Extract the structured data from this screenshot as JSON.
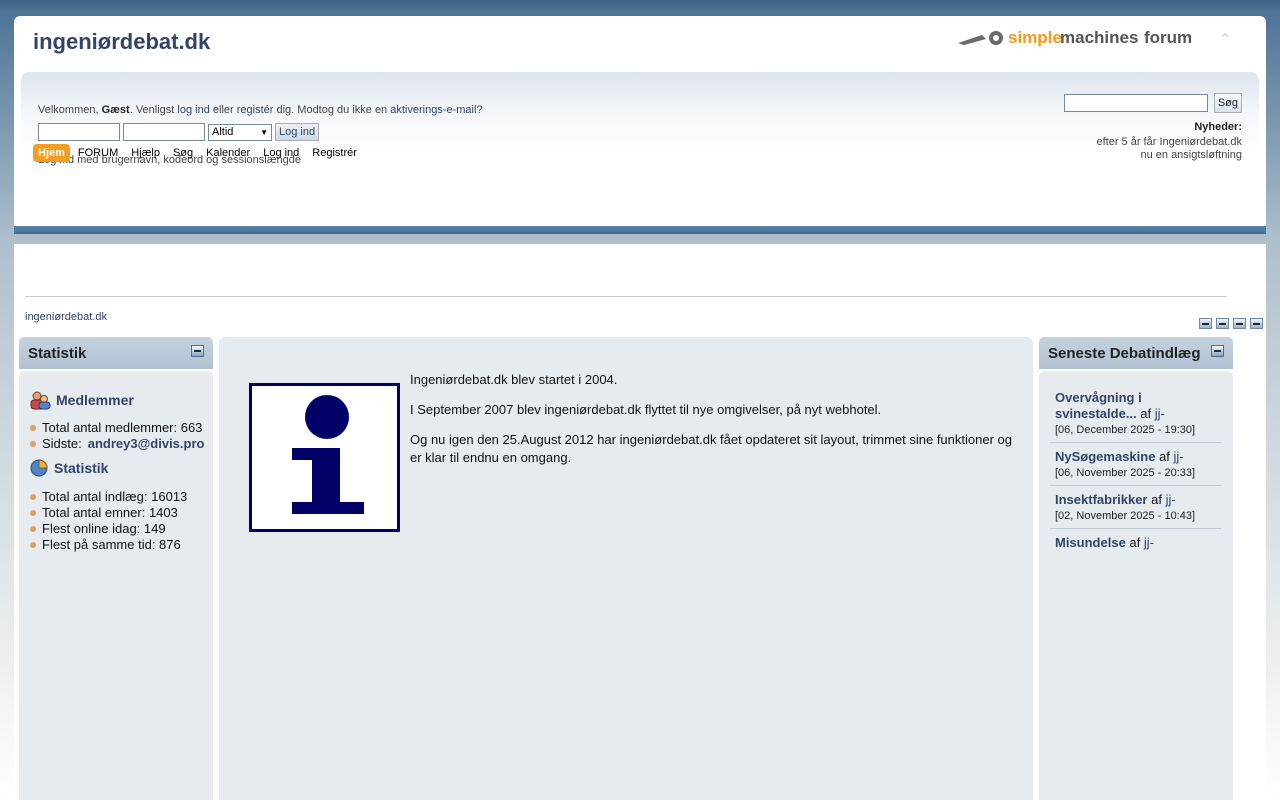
{
  "header": {
    "site_title": "ingeniørdebat.dk",
    "logo_text_1": "simple",
    "logo_text_2": "machines",
    "logo_text_3": " forum",
    "collapse_icon": "chevron-up-icon"
  },
  "login": {
    "welcome_prefix": "Velkommen, ",
    "guest": "Gæst",
    "welcome_mid": ". Venligst ",
    "login_link": "log ind",
    "or": " eller ",
    "register_link": "registér",
    "mid2": " dig. Modtog du ikke en ",
    "activation_link": "aktiverings-e-mail",
    "suffix": "?",
    "session_value": "Altid",
    "login_button": "Log ind",
    "hint": "Log ind med brugernavn, kodeord og sessionslængde"
  },
  "search": {
    "button": "Søg",
    "value": ""
  },
  "news": {
    "title": "Nyheder:",
    "line1": "efter 5 år får Ingeniørdebat.dk",
    "line2": "nu en ansigtsløftning"
  },
  "menu": {
    "items": [
      {
        "label": "Hjem",
        "active": true
      },
      {
        "label": "FORUM"
      },
      {
        "label": "Hjælp"
      },
      {
        "label": "Søg"
      },
      {
        "label": "Kalender"
      },
      {
        "label": "Log ind"
      },
      {
        "label": "Registrér"
      }
    ]
  },
  "breadcrumb": "ingeniørdebat.dk",
  "left_panel": {
    "title": "Statistik",
    "members_heading": "Medlemmer",
    "total_members_label": "Total antal medlemmer: 663",
    "latest_label": "Sidste: ",
    "latest_member": "andrey3@divis.pro",
    "stats_heading": "Statistik",
    "stats": [
      "Total antal indlæg: 16013",
      "Total antal emner: 1403",
      "Flest online idag: 149",
      "Flest på samme tid: 876"
    ]
  },
  "center": {
    "paragraphs": [
      "Ingeniørdebat.dk blev startet i 2004.",
      "I September 2007 blev ingeniørdebat.dk flyttet til nye omgivelser, på nyt webhotel.",
      "Og nu igen den 25.August 2012 har ingeniørdebat.dk fået opdateret sit layout, trimmet sine funktioner og er klar til endnu en omgang."
    ]
  },
  "right_panel": {
    "title": "Seneste Debatindlæg",
    "by": "af",
    "posts": [
      {
        "title": "Overvågning i svinestalde...",
        "author": "jj-",
        "date": "[06, December 2025 - 19:30]"
      },
      {
        "title": "NySøgemaskine",
        "author": "jj-",
        "date": "[06, November 2025 - 20:33]"
      },
      {
        "title": "Insektfabrikker",
        "author": "jj-",
        "date": "[02, November 2025 - 10:43]"
      },
      {
        "title": "Misundelse",
        "author": "jj-",
        "date": ""
      }
    ]
  },
  "colors": {
    "accent": "#f59d22",
    "link": "#334466",
    "panel_bg": "#e6ebf0",
    "info_icon": "#000066"
  }
}
